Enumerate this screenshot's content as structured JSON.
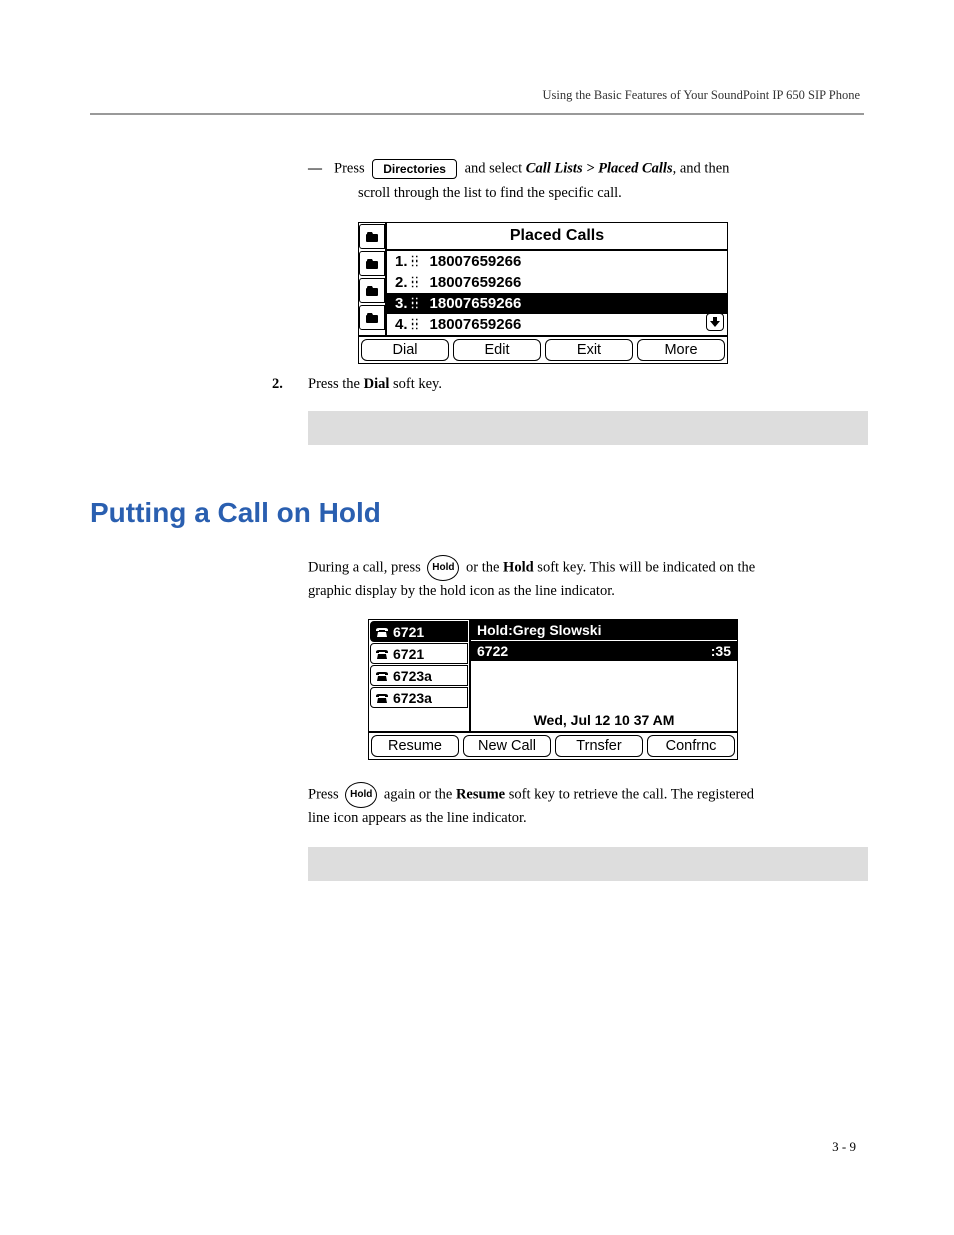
{
  "running_head": "Using the Basic Features of Your SoundPoint IP 650 SIP Phone",
  "step1": {
    "dash": "—",
    "press": "Press",
    "button_label": "Directories",
    "tail1": " and select ",
    "path": "Call Lists > Placed Calls",
    "tail2": ", and then",
    "line2": "scroll through the list to find the specific call."
  },
  "lcd1": {
    "title": "Placed Calls",
    "rows": [
      {
        "idx": "1.",
        "num": "18007659266",
        "sel": false
      },
      {
        "idx": "2.",
        "num": "18007659266",
        "sel": false
      },
      {
        "idx": "3.",
        "num": "18007659266",
        "sel": true
      },
      {
        "idx": "4.",
        "num": "18007659266",
        "sel": false
      }
    ],
    "softkeys": [
      "Dial",
      "Edit",
      "Exit",
      "More"
    ]
  },
  "step2": {
    "n": "2.",
    "text_a": "Press the ",
    "text_b": "Dial",
    "text_c": " soft key."
  },
  "section_title": "Putting a Call on Hold",
  "hold_para1": {
    "a": "During a call, press ",
    "btn": "Hold",
    "b": " or the ",
    "c": "Hold",
    "d": " soft key. This will be indicated on the",
    "line2": "graphic display by the hold icon as the line indicator."
  },
  "lcd2": {
    "lines": [
      {
        "label": "6721",
        "sel": true
      },
      {
        "label": "6721",
        "sel": false
      },
      {
        "label": "6723a",
        "sel": false
      },
      {
        "label": "6723a",
        "sel": false
      }
    ],
    "hold_title": "Hold:Greg Slowski",
    "call_num": "6722",
    "call_dur": ":35",
    "date": "Wed, Jul 12  10 37 AM",
    "softkeys": [
      "Resume",
      "New Call",
      "Trnsfer",
      "Confrnc"
    ]
  },
  "hold_para2": {
    "a": "Press ",
    "btn": "Hold",
    "b": " again or the ",
    "c": "Resume",
    "d": " soft key to retrieve the call. The registered",
    "line2": "line icon appears as the line indicator."
  },
  "page_num": "3 - 9"
}
